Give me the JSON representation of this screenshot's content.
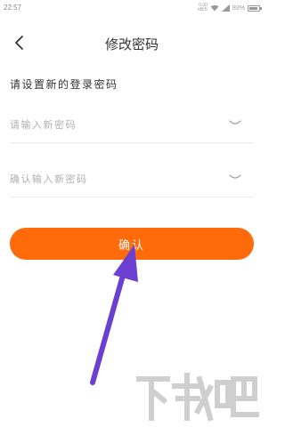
{
  "status_bar": {
    "time": "22:57",
    "net_speed_value": "0.00",
    "net_speed_unit": "kB/S",
    "battery": "83%"
  },
  "header": {
    "title": "修改密码"
  },
  "form": {
    "section_label": "请设置新的登录密码",
    "new_password_placeholder": "请输入新密码",
    "confirm_password_placeholder": "确认输入新密码",
    "new_password_value": "",
    "confirm_password_value": ""
  },
  "actions": {
    "confirm_label": "确认"
  },
  "colors": {
    "accent": "#ff6a0a",
    "annotation_arrow": "#6a3fd1"
  }
}
